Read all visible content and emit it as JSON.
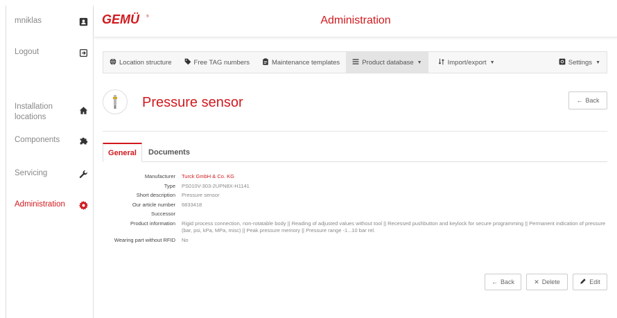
{
  "sidebar": {
    "user": {
      "label": "mniklas",
      "icon": "id-card-icon"
    },
    "logout": {
      "label": "Logout",
      "icon": "sign-out-icon"
    },
    "items": [
      {
        "label": "Installation locations",
        "icon": "home-icon"
      },
      {
        "label": "Components",
        "icon": "puzzle-icon"
      },
      {
        "label": "Servicing",
        "icon": "wrench-icon"
      },
      {
        "label": "Administration",
        "icon": "gear-icon"
      }
    ]
  },
  "header": {
    "logo_text": "GEMÜ",
    "title": "Administration"
  },
  "navbar": {
    "items": [
      {
        "label": "Location structure",
        "icon": "globe-icon"
      },
      {
        "label": "Free TAG numbers",
        "icon": "tag-icon"
      },
      {
        "label": "Maintenance templates",
        "icon": "clipboard-icon"
      },
      {
        "label": "Product database",
        "icon": "list-icon",
        "caret": "▼"
      },
      {
        "label": "Import/export",
        "icon": "sort-icon",
        "caret": "▼"
      },
      {
        "label": "Settings",
        "icon": "settings-icon",
        "caret": "▼"
      }
    ]
  },
  "product": {
    "title": "Pressure sensor",
    "back_label": "Back"
  },
  "tabs": [
    {
      "label": "General"
    },
    {
      "label": "Documents"
    }
  ],
  "details": [
    {
      "key": "Manufacturer",
      "value": "Turck GmbH & Co. KG"
    },
    {
      "key": "Type",
      "value": "PS010V-303-2UPN8X-H1141"
    },
    {
      "key": "Short description",
      "value": "Pressure sensor"
    },
    {
      "key": "Our article number",
      "value": "6833418"
    },
    {
      "key": "Successor",
      "value": ""
    },
    {
      "key": "Product information",
      "value": "Rigid process connection, non-rotatable body || Reading of adjusted values without tool || Recessed pushbutton and keylock for secure programming || Permanent indication of pressure (bar, psi, kPa, MPa, misc) || Peak pressure memory || Pressure range -1...10 bar rel."
    },
    {
      "key": "Wearing part without RFID",
      "value": "No"
    }
  ],
  "actions": {
    "back": "Back",
    "delete": "Delete",
    "edit": "Edit"
  },
  "colors": {
    "accent": "#d0191e",
    "navbar_bg": "#f7f7f7",
    "active_nav": "#e4e4e4"
  }
}
